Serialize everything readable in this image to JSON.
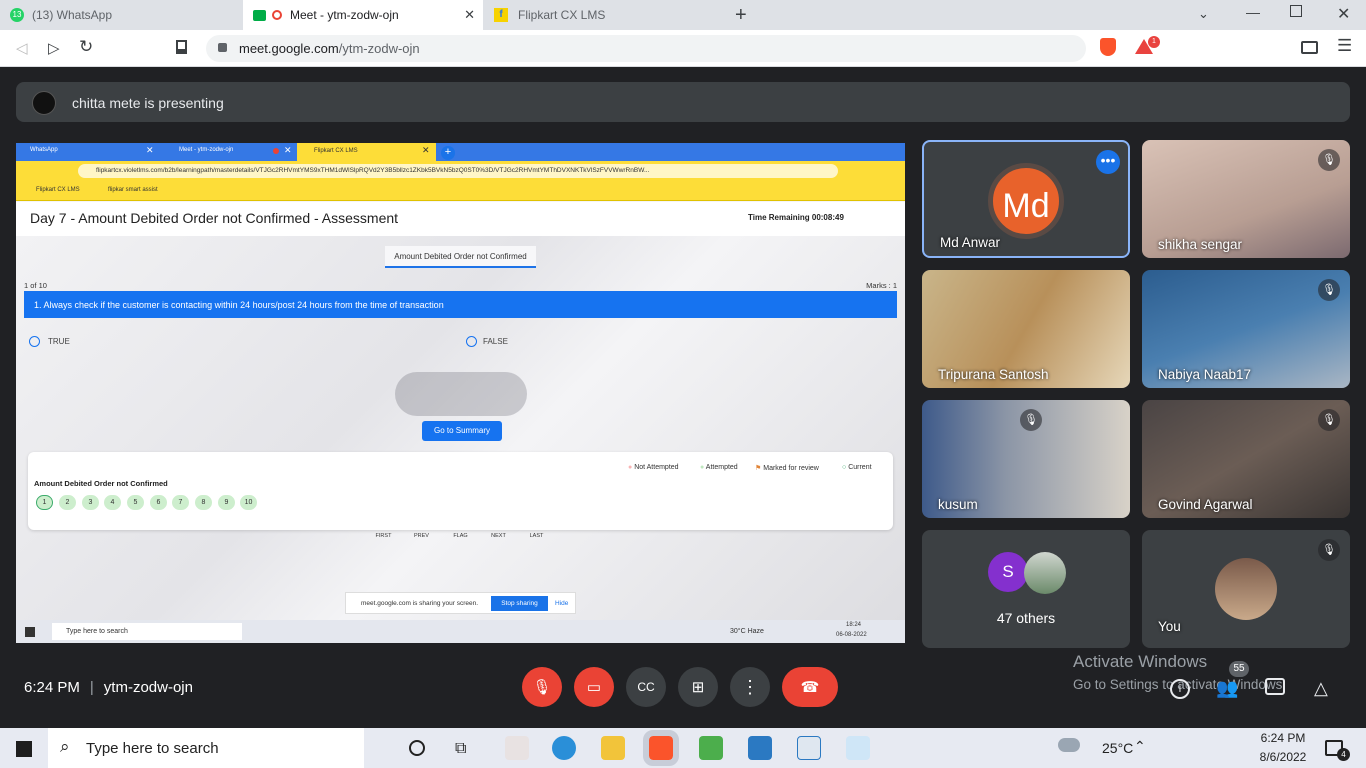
{
  "browser": {
    "tabs": [
      {
        "label": "(13) WhatsApp",
        "badge": "13"
      },
      {
        "label": "Meet - ytm-zodw-ojn"
      },
      {
        "label": "Flipkart CX LMS"
      }
    ],
    "url_domain": "meet.google.com",
    "url_path": "/ytm-zodw-ojn",
    "ext_badge": "1"
  },
  "presenting_banner": "chitta mete is presenting",
  "shared_screen": {
    "tabs": [
      "WhatsApp",
      "Meet - ytm-zodw-ojn",
      "Flipkart CX LMS"
    ],
    "url": "flipkartcx.violetlms.com/b2b/learningpath/masterdetails/VTJGc2RHVmtYMS9xTHM1dWlSlpRQVd2Y3B5bllzc1ZKbk5BVkN5bzQ0ST0%3D/VTJGc2RHVmtYMThDVXNKTkVlSzFVVWwrRnBW...",
    "bookmarks": [
      "Flipkart CX LMS",
      "flipkar smart assist"
    ],
    "page_title": "Day 7 - Amount Debited Order not Confirmed - Assessment",
    "time_remaining": "Time Remaining 00:08:49",
    "section_tab": "Amount Debited Order not Confirmed",
    "question_index": "1 of 10",
    "marks": "Marks : 1",
    "question": "1. Always check if the customer is contacting within 24 hours/post 24 hours from the time of transaction",
    "options": [
      "TRUE",
      "FALSE"
    ],
    "nav": [
      "FIRST",
      "PREV",
      "FLAG",
      "NEXT",
      "LAST"
    ],
    "summary_button": "Go to Summary",
    "legend": [
      "Not Attempted",
      "Attempted",
      "Marked for review",
      "Current"
    ],
    "summary_title": "Amount Debited Order not Confirmed",
    "question_numbers": [
      "1",
      "2",
      "3",
      "4",
      "5",
      "6",
      "7",
      "8",
      "9",
      "10"
    ],
    "share_notice": "meet.google.com is sharing your screen.",
    "stop_sharing": "Stop sharing",
    "hide": "Hide",
    "taskbar_search": "Type here to search",
    "weather": "30°C  Haze",
    "time": "18:24",
    "date": "06-08-2022"
  },
  "participants": [
    {
      "name": "Md Anwar",
      "initials": "Md"
    },
    {
      "name": "shikha sengar"
    },
    {
      "name": "Tripurana Santosh"
    },
    {
      "name": "Nabiya Naab17"
    },
    {
      "name": "kusum"
    },
    {
      "name": "Govind Agarwal"
    },
    {
      "name": "47 others",
      "avatar_letter": "S"
    },
    {
      "name": "You"
    }
  ],
  "bottom_bar": {
    "time": "6:24 PM",
    "meeting_code": "ytm-zodw-ojn",
    "people_count": "55"
  },
  "watermark": {
    "title": "Activate Windows",
    "subtitle": "Go to Settings to activate Windows."
  },
  "taskbar": {
    "search": "Type here to search",
    "temperature": "25°C",
    "time": "6:24 PM",
    "date": "8/6/2022",
    "notifications": "4"
  }
}
